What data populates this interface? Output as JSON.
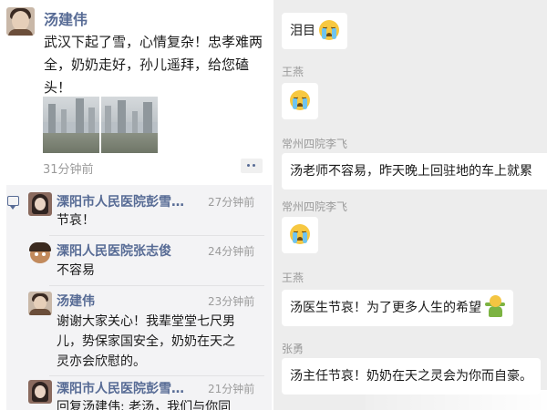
{
  "moments_post": {
    "author": "汤建伟",
    "text": "武汉下起了雪，心情复杂！忠孝难两全，奶奶走好，孙儿遥拜，给您磕头！",
    "time": "31分钟前",
    "photos": [
      "snow-photo-1",
      "snow-photo-2"
    ]
  },
  "comments": [
    {
      "name": "溧阳市人民医院彭雪…",
      "time": "27分钟前",
      "text": "节哀！"
    },
    {
      "name": "溧阳人民医院张志俊",
      "time": "24分钟前",
      "text": "不容易"
    },
    {
      "name": "汤建伟",
      "time": "23分钟前",
      "text_lines": [
        "谢谢大家关心！我辈堂堂七尺男",
        "儿，势保家国安全，奶奶在天之",
        "灵亦会欣慰的。"
      ]
    },
    {
      "name": "溧阳市人民医院彭雪…",
      "time": "21分钟前",
      "text": "回复汤建伟: 老汤，我们与你同"
    }
  ],
  "chat": {
    "messages": [
      {
        "sender": "",
        "text": "泪目",
        "emoji": "crying-emoji"
      },
      {
        "sender": "王燕",
        "text": "",
        "emoji": "crying-emoji"
      },
      {
        "sender": "常州四院李飞",
        "text": "汤老师不容易，昨天晚上回驻地的车上就累",
        "emoji": ""
      },
      {
        "sender": "常州四院李飞",
        "text": "",
        "emoji": "crying-emoji"
      },
      {
        "sender": "王燕",
        "text": "汤医生节哀！为了更多人生的希望",
        "emoji": "cheer-emoji"
      },
      {
        "sender": "张勇",
        "text": "汤主任节哀！奶奶在天之灵会为你而自豪。",
        "emoji": ""
      }
    ]
  },
  "colors": {
    "name_link": "#576b95",
    "chat_background": "#ededed",
    "comment_background": "#f3f3f5"
  }
}
